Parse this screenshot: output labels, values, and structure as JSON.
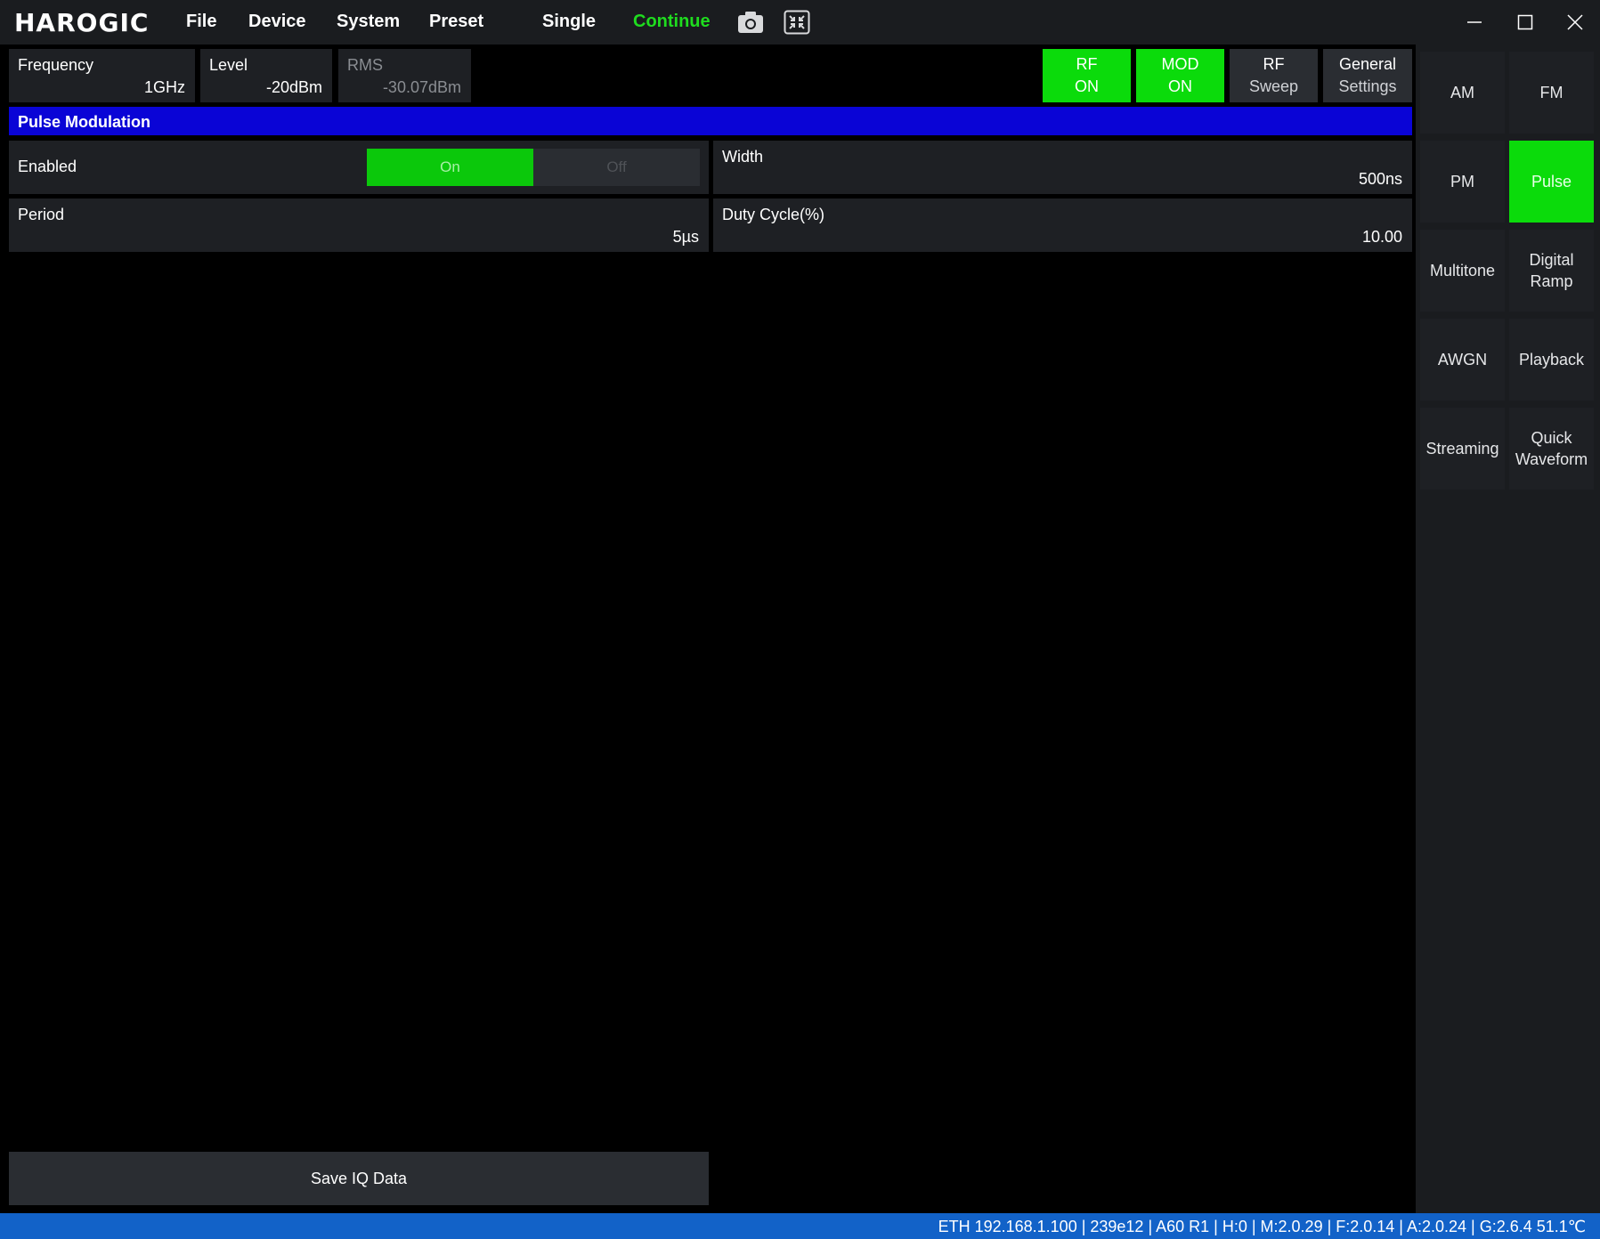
{
  "titlebar": {
    "logo": "HAROGIC",
    "menu": [
      "File",
      "Device",
      "System",
      "Preset"
    ],
    "single": "Single",
    "continue": "Continue",
    "icons": [
      "camera-icon",
      "collapse-icon"
    ],
    "window_controls": [
      "minimize-icon",
      "maximize-icon",
      "close-icon"
    ]
  },
  "params": {
    "frequency": {
      "label": "Frequency",
      "value": "1GHz"
    },
    "level": {
      "label": "Level",
      "value": "-20dBm"
    },
    "rms": {
      "label": "RMS",
      "value": "-30.07dBm"
    }
  },
  "toggles": {
    "rf": {
      "line1": "RF",
      "line2": "ON"
    },
    "mod": {
      "line1": "MOD",
      "line2": "ON"
    },
    "rf_sweep": {
      "line1": "RF",
      "line2": "Sweep"
    },
    "general": {
      "line1": "General",
      "line2": "Settings"
    }
  },
  "section": {
    "title": "Pulse Modulation"
  },
  "fields": {
    "enabled": {
      "label": "Enabled",
      "on": "On",
      "off": "Off"
    },
    "width": {
      "label": "Width",
      "value": "500ns"
    },
    "period": {
      "label": "Period",
      "value": "5µs"
    },
    "duty": {
      "label": "Duty Cycle(%)",
      "value": "10.00"
    }
  },
  "modes": [
    {
      "label": "AM"
    },
    {
      "label": "FM"
    },
    {
      "label": "PM"
    },
    {
      "label": "Pulse"
    },
    {
      "label": "Multitone"
    },
    {
      "label": "Digital Ramp"
    },
    {
      "label": "AWGN"
    },
    {
      "label": "Playback"
    },
    {
      "label": "Streaming"
    },
    {
      "label": "Quick Waveform"
    }
  ],
  "active_mode": "Pulse",
  "save_button": "Save IQ Data",
  "status": "ETH 192.168.1.100 | 239e12 | A60 R1 | H:0 | M:2.0.29 | F:2.0.14 | A:2.0.24 | G:2.6.4  51.1℃",
  "colors": {
    "accent_green": "#0bdb0b",
    "section_blue": "#0a04d6",
    "status_blue": "#1262c8"
  }
}
